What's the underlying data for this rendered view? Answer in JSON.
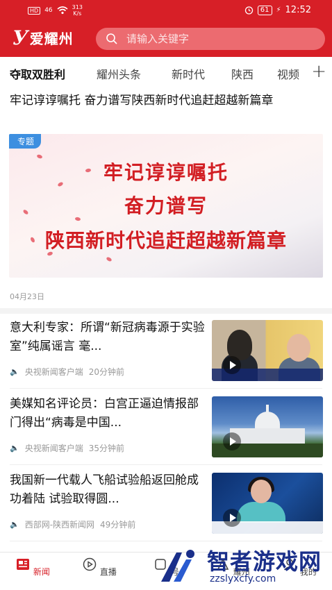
{
  "status_bar": {
    "hd": "HD",
    "signal": "46",
    "net_speed_value": "313",
    "net_speed_unit": "K/s",
    "battery": "61",
    "time": "12:52"
  },
  "header": {
    "logo_mark": "У",
    "logo_text": "爱耀州",
    "search_placeholder": "请输入关键字"
  },
  "tabs": [
    {
      "label": "夺取双胜利",
      "active": true
    },
    {
      "label": "耀州头条",
      "active": false
    },
    {
      "label": "新时代",
      "active": false
    },
    {
      "label": "陕西",
      "active": false
    },
    {
      "label": "视频",
      "active": false
    }
  ],
  "tabs_add": "+",
  "featured": {
    "headline": "牢记谆谆嘱托 奋力谱写陕西新时代追赶超越新篇章",
    "tag": "专题",
    "banner_lines": [
      "牢记谆谆嘱托",
      "奋力谱写",
      "陕西新时代追赶超越新篇章"
    ],
    "date": "04月23日"
  },
  "news": [
    {
      "title": "意大利专家：所谓“新冠病毒源于实验室”纯属谣言 毫...",
      "source": "央视新闻客户端",
      "time": "20分钟前"
    },
    {
      "title": "美媒知名评论员：白宫正逼迫情报部门得出“病毒是中国...",
      "source": "央视新闻客户端",
      "time": "35分钟前"
    },
    {
      "title": "我国新一代载人飞船试验船返回舱成功着陆 试验取得圆...",
      "source": "西部网-陕西新闻网",
      "time": "49分钟前"
    }
  ],
  "bottom_nav": [
    {
      "label": "新闻",
      "active": true
    },
    {
      "label": "直播",
      "active": false
    },
    {
      "label": "号",
      "active": false
    },
    {
      "label": "耀州",
      "active": false
    },
    {
      "label": "我的",
      "active": false
    }
  ],
  "watermark": {
    "text": "智者游戏网",
    "url": "zzslyxcfy.com"
  },
  "colors": {
    "brand_red": "#d71f27",
    "tag_blue": "#3d8fe0",
    "watermark_blue": "#1a2f8a"
  }
}
